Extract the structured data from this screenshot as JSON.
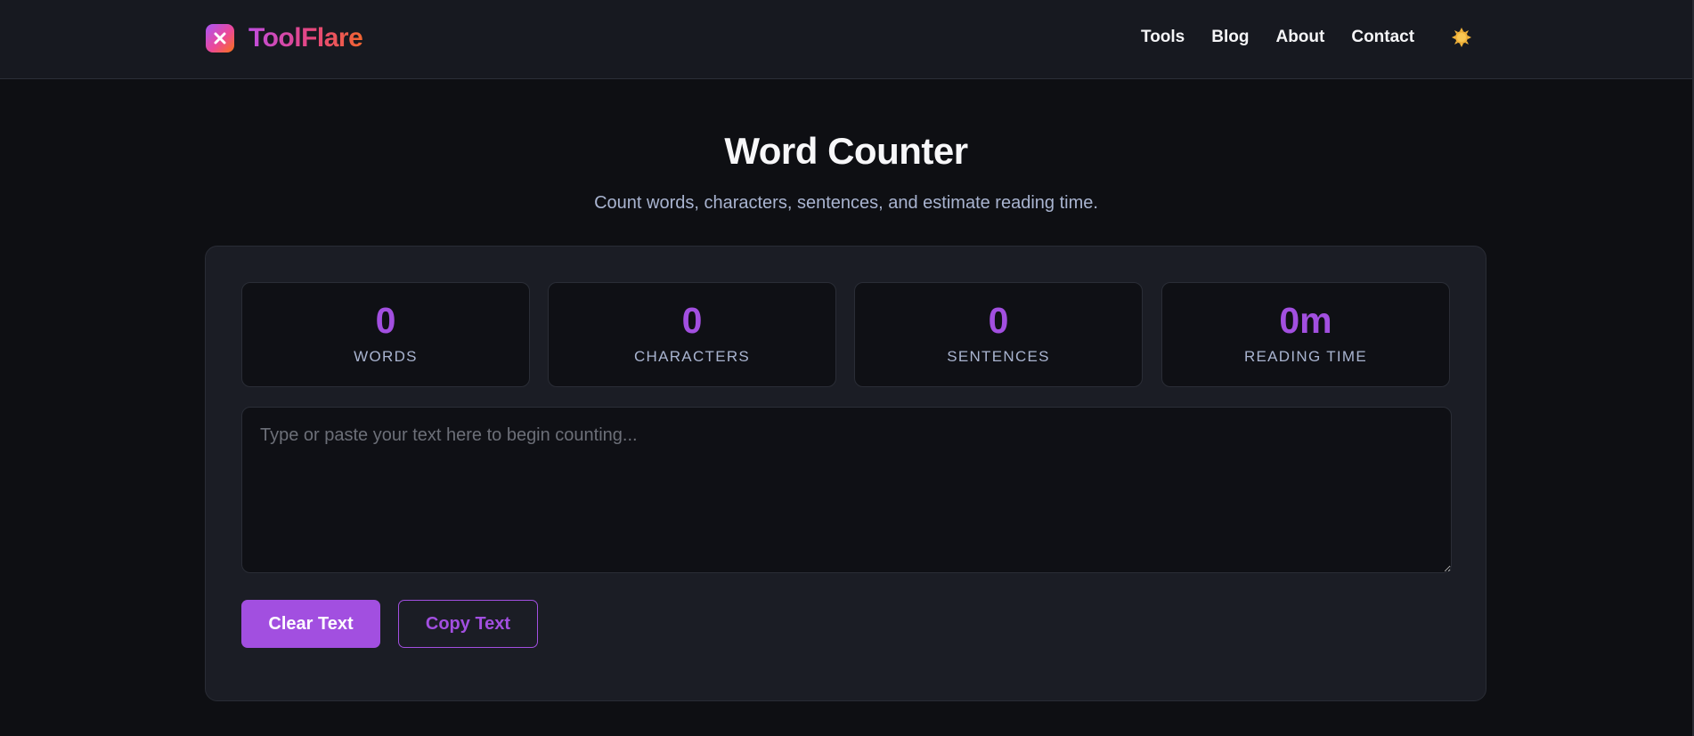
{
  "brand": {
    "name": "ToolFlare",
    "logo_icon": "close-x-icon"
  },
  "nav": {
    "items": [
      {
        "label": "Tools"
      },
      {
        "label": "Blog"
      },
      {
        "label": "About"
      },
      {
        "label": "Contact"
      }
    ],
    "theme_toggle_icon": "sun-icon"
  },
  "page": {
    "title": "Word Counter",
    "subtitle": "Count words, characters, sentences, and estimate reading time."
  },
  "stats": [
    {
      "value": "0",
      "label": "WORDS"
    },
    {
      "value": "0",
      "label": "CHARACTERS"
    },
    {
      "value": "0",
      "label": "SENTENCES"
    },
    {
      "value": "0m",
      "label": "READING TIME"
    }
  ],
  "editor": {
    "value": "",
    "placeholder": "Type or paste your text here to begin counting..."
  },
  "actions": {
    "clear_label": "Clear Text",
    "copy_label": "Copy Text"
  },
  "colors": {
    "accent": "#a24fe0",
    "background": "#0e0f13",
    "card": "#1b1d25",
    "header": "#171920",
    "muted_text": "#a9b4d0"
  }
}
